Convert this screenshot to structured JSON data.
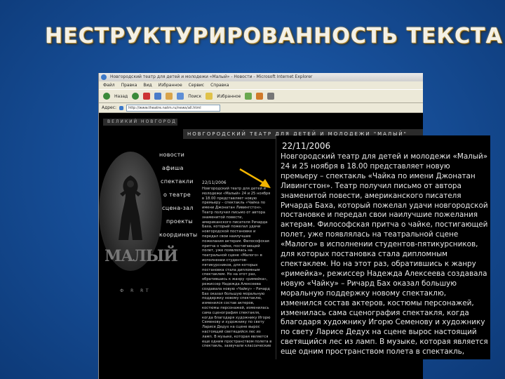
{
  "slide": {
    "title": "НЕСТРУКТУРИРОВАННОСТЬ ТЕКСТА"
  },
  "browser": {
    "window_title": "Новгородский театр для детей и молодежи «Малый» - Новости - Microsoft Internet Explorer",
    "menu": [
      "Файл",
      "Правка",
      "Вид",
      "Избранное",
      "Сервис",
      "Справка"
    ],
    "toolbar": {
      "back_label": "Назад",
      "search_label": "Поиск",
      "favorites_label": "Избранное"
    },
    "address_label": "Адрес:",
    "address_value": "http://www.theatre.natm.ru/news/all.html"
  },
  "site": {
    "city": "ВЕЛИКИЙ НОВГОРОД",
    "theatre_name": "НОВГОРОДСКИЙ ТЕАТР ДЛЯ ДЕТЕЙ И МОЛОДЕЖИ \"МАЛЫЙ\"",
    "logo_text": "МАЛЫЙ",
    "nav": [
      "новости",
      "афиша",
      "спектакли",
      "о театре",
      "сцена-зал",
      "проекты",
      "координаты"
    ],
    "copyright": "Ф   R   RT",
    "news_date": "22/11/2006",
    "news_text": "Новгородский театр для детей и молодежи «Малый» 24 и 25 ноября в 18.00 представляет новую премьеру – спектакль «Чайка по имени Джонатан Ливингстон». Театр получил письмо от автора знаменитой повести, американского писателя Ричарда Баха, который пожелал удачи новгородской постановке и передал свои наилучшие пожелания актерам. Философская притча о чайке, постигающей полет, уже появлялась на театральной сцене «Малого» в исполнении студентов-пятикурсников, для которых постановка стала дипломным спектаклем. Но на этот раз, обратившись к жанру «римейка», режиссер Надежда Алексеева создавала новую «Чайку» – Ричард Бах оказал большую моральную поддержку новому спектаклю, изменился состав актеров, костюмы персонажей, изменилась сама сценография спектакля, когда благодаря художнику Игорю Семенову и художнику по свету Ларисе Дедух на сцене вырос настоящий светящийся лес из ламп. В музыке, которая является еще одним пространством полета в спектакль, зазвучали классические"
  },
  "zoom": {
    "date": "22/11/2006",
    "text": "Новгородский театр для детей и молодежи «Малый» 24 и 25 ноября в 18.00 представляет новую премьеру – спектакль «Чайка по имени Джонатан Ливингстон». Театр получил письмо от автора знаменитой повести, американского писателя Ричарда Баха, который пожелал удачи новгородской постановке и передал свои наилучшие пожелания актерам. Философская притча о чайке, постигающей полет, уже появлялась на театральной сцене «Малого» в исполнении студентов-пятикурсников, для которых постановка стала дипломным спектаклем. Но на этот раз, обратившись к жанру «римейка», режиссер Надежда Алексеева создавала новую «Чайку» – Ричард Бах оказал большую моральную поддержку новому спектаклю, изменился состав актеров, костюмы персонажей, изменилась сама сценография спектакля, когда благодаря художнику Игорю Семенову и художнику по свету Ларисе Дедух на сцене вырос настоящий светящийся лес из ламп. В музыке, которая является еще одним пространством полета в спектакль, зазвучали классические"
  },
  "colors": {
    "slide_bg": "#1a55a3",
    "title": "#f4f1e6",
    "arrow": "#f2b400"
  }
}
